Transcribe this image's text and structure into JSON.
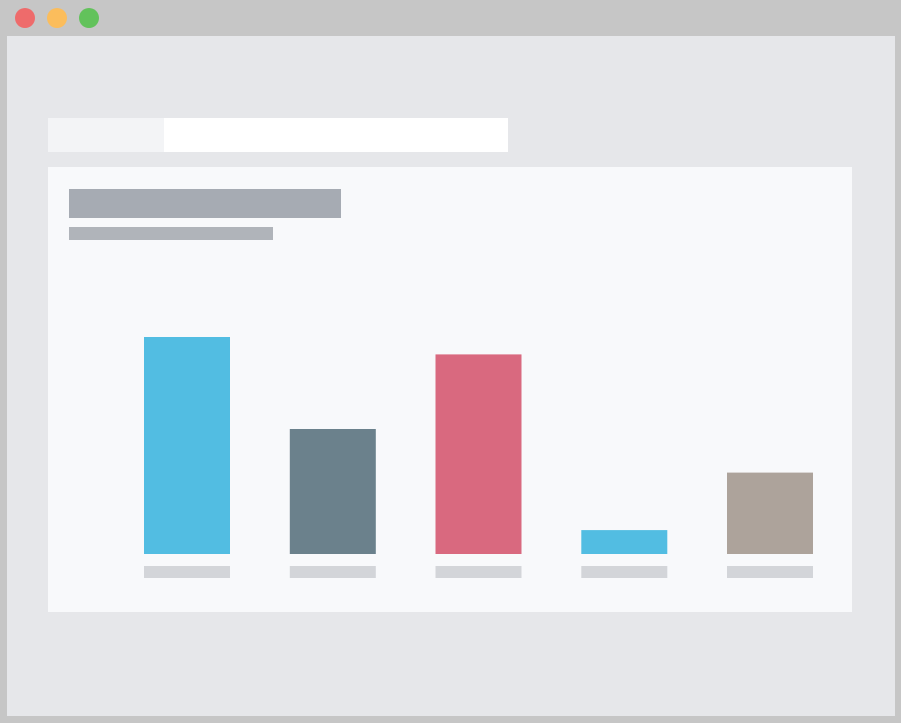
{
  "window": {
    "controls": [
      "close-icon",
      "minimize-icon",
      "maximize-icon"
    ],
    "colors": {
      "close": "#ee6b6b",
      "minimize": "#fbbd5c",
      "maximize": "#62c25b"
    }
  },
  "chart_data": {
    "type": "bar",
    "categories": [
      "",
      "",
      "",
      "",
      ""
    ],
    "values": [
      100,
      57.6,
      92,
      11,
      37.5
    ],
    "colors": [
      "#52bde2",
      "#6b818c",
      "#d9697f",
      "#52bde2",
      "#ada39b"
    ],
    "ylim": [
      0,
      100
    ],
    "grid": false,
    "legend": "none",
    "title": "",
    "xlabel": "",
    "ylabel": ""
  }
}
